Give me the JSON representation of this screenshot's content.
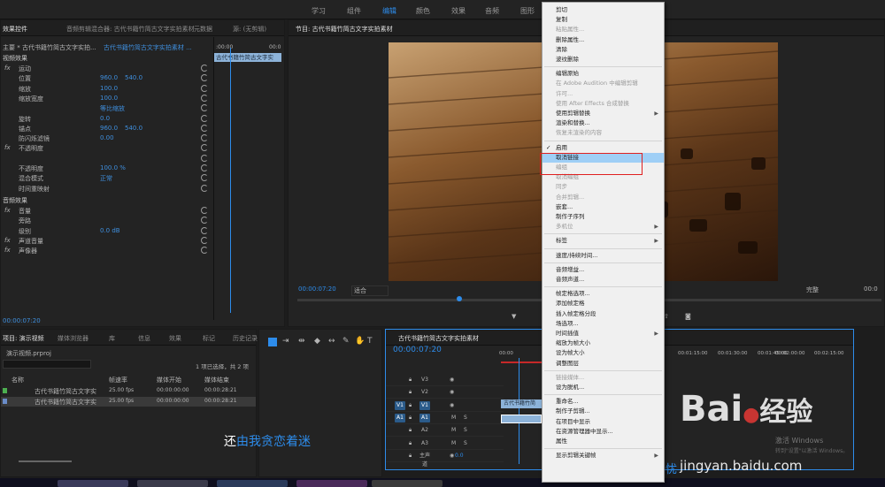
{
  "workspaces": [
    "学习",
    "组件",
    "编辑",
    "颜色",
    "效果",
    "音频",
    "图形"
  ],
  "effect_panel": {
    "tabs": [
      "效果控件",
      "音频剪辑混合器: 古代书籍竹简古文字实拍素材",
      "元数据",
      "源: (无剪辑)"
    ],
    "source_row": "主要 * 古代书籍竹简古文字实拍...",
    "clip_row": "古代书籍竹简古文字实拍素材 ...",
    "clip_bar": "古代书籍竹简古文字实",
    "section_video": "视频效果",
    "rows": [
      {
        "fx": "fx",
        "label": "运动",
        "v1": "",
        "v2": ""
      },
      {
        "fx": "",
        "label": "位置",
        "v1": "960.0",
        "v2": "540.0"
      },
      {
        "fx": "",
        "label": "缩放",
        "v1": "100.0",
        "v2": ""
      },
      {
        "fx": "",
        "label": "缩放宽度",
        "v1": "100.0",
        "v2": ""
      },
      {
        "fx": "",
        "label": "",
        "v1": "等比缩放",
        "v2": ""
      },
      {
        "fx": "",
        "label": "旋转",
        "v1": "0.0",
        "v2": ""
      },
      {
        "fx": "",
        "label": "锚点",
        "v1": "960.0",
        "v2": "540.0"
      },
      {
        "fx": "",
        "label": "防闪烁滤镜",
        "v1": "0.00",
        "v2": ""
      },
      {
        "fx": "fx",
        "label": "不透明度",
        "v1": "",
        "v2": ""
      },
      {
        "fx": "",
        "label": "",
        "v1": "",
        "v2": ""
      },
      {
        "fx": "",
        "label": "不透明度",
        "v1": "100.0 %",
        "v2": ""
      },
      {
        "fx": "",
        "label": "混合模式",
        "v1": "正常",
        "v2": ""
      },
      {
        "fx": "",
        "label": "时间重映射",
        "v1": "",
        "v2": ""
      }
    ],
    "section_audio": "音频效果",
    "audio_rows": [
      {
        "fx": "fx",
        "label": "音量",
        "v1": ""
      },
      {
        "fx": "",
        "label": "旁路",
        "v1": ""
      },
      {
        "fx": "",
        "label": "级别",
        "v1": "0.0 dB"
      },
      {
        "fx": "fx",
        "label": "声道音量",
        "v1": ""
      },
      {
        "fx": "fx",
        "label": "声像器",
        "v1": ""
      }
    ],
    "timecode": "00:00:07:20",
    "ruler_start": ":00:00",
    "ruler_end": "00:0"
  },
  "program": {
    "title": "节目: 古代书籍竹简古文字实拍素材",
    "timecode": "00:00:07:20",
    "fit": "适合",
    "quality": "完整",
    "right_tc": "00:0"
  },
  "project": {
    "tabs": [
      "项目: 演示视频",
      "媒体浏览器",
      "库",
      "信息",
      "效果",
      "标记",
      "历史记录"
    ],
    "file": "演示视频.prproj",
    "selection": "1 项已选择，共 2 项",
    "headers": [
      "名称",
      "帧速率",
      "媒体开始",
      "媒体结束"
    ],
    "items": [
      {
        "name": "古代书籍竹简古文字实",
        "fps": "25.00 fps",
        "start": "00:00:00:00",
        "end": "00:00:28:21"
      },
      {
        "name": "古代书籍竹简古文字实",
        "fps": "25.00 fps",
        "start": "00:00:00:00",
        "end": "00:00:28:21"
      }
    ]
  },
  "timeline": {
    "title": "古代书籍竹简古文字实拍素材",
    "timecode": "00:00:07:20",
    "tracks": [
      "V3",
      "V2",
      "V1",
      "A1",
      "A2",
      "A3",
      "主声道"
    ],
    "master_value": "0.0",
    "ruler": [
      "00:00",
      "00:01:15:00",
      "00:01:30:00",
      "00:01:45:00",
      "00:02:00:00",
      "00:02:15:00"
    ],
    "clip_label": "古代书籍竹简"
  },
  "subtitle": {
    "first": "还",
    "rest": "由我贪恋着迷",
    "last": "忧"
  },
  "context_menu": {
    "items": [
      {
        "label": "剪切",
        "disabled": false
      },
      {
        "label": "复制",
        "disabled": false
      },
      {
        "label": "粘贴属性...",
        "disabled": true
      },
      {
        "label": "删除属性...",
        "disabled": false
      },
      {
        "label": "清除",
        "disabled": false
      },
      {
        "label": "波纹删除",
        "disabled": false
      },
      {
        "sep": true
      },
      {
        "label": "编辑原始",
        "disabled": false
      },
      {
        "label": "在 Adobe Audition 中编辑剪辑",
        "disabled": true
      },
      {
        "label": "许可...",
        "disabled": true
      },
      {
        "label": "使用 After Effects 合成替换",
        "disabled": true
      },
      {
        "label": "使用剪辑替换",
        "disabled": false,
        "sub": true
      },
      {
        "label": "渲染和替换...",
        "disabled": false
      },
      {
        "label": "恢复未渲染的内容",
        "disabled": true
      },
      {
        "sep": true
      },
      {
        "label": "启用",
        "disabled": false,
        "check": true
      },
      {
        "label": "取消链接",
        "disabled": false,
        "highlight": true
      },
      {
        "label": "编组",
        "disabled": true
      },
      {
        "label": "取消编组",
        "disabled": true
      },
      {
        "label": "同步",
        "disabled": true
      },
      {
        "label": "合并剪辑...",
        "disabled": true
      },
      {
        "label": "嵌套...",
        "disabled": false
      },
      {
        "label": "制作子序列",
        "disabled": false
      },
      {
        "label": "多机位",
        "disabled": true,
        "sub": true
      },
      {
        "sep": true
      },
      {
        "label": "标签",
        "disabled": false,
        "sub": true
      },
      {
        "sep": true
      },
      {
        "label": "速度/持续时间...",
        "disabled": false
      },
      {
        "sep": true
      },
      {
        "label": "音频增益...",
        "disabled": false
      },
      {
        "label": "音频声道...",
        "disabled": false
      },
      {
        "sep": true
      },
      {
        "label": "帧定格选项...",
        "disabled": false
      },
      {
        "label": "添加帧定格",
        "disabled": false
      },
      {
        "label": "插入帧定格分段",
        "disabled": false
      },
      {
        "label": "场选项...",
        "disabled": false
      },
      {
        "label": "时间插值",
        "disabled": false,
        "sub": true
      },
      {
        "label": "缩放为帧大小",
        "disabled": false
      },
      {
        "label": "设为帧大小",
        "disabled": false
      },
      {
        "label": "调整图层",
        "disabled": false
      },
      {
        "sep": true
      },
      {
        "label": "链接媒体...",
        "disabled": true
      },
      {
        "label": "设为脱机...",
        "disabled": false
      },
      {
        "sep": true
      },
      {
        "label": "重命名...",
        "disabled": false
      },
      {
        "label": "制作子剪辑...",
        "disabled": false
      },
      {
        "label": "在项目中显示",
        "disabled": false
      },
      {
        "label": "在资源管理器中显示...",
        "disabled": false
      },
      {
        "label": "属性",
        "disabled": false
      },
      {
        "sep": true
      },
      {
        "label": "显示剪辑关键帧",
        "disabled": false,
        "sub": true
      }
    ]
  },
  "watermark": {
    "brand": "Bai",
    "brand2": "经验",
    "url": "jingyan.baidu.com",
    "win1": "激活 Windows",
    "win2": "转到\"设置\"以激活 Windows。"
  },
  "colors": {
    "accent": "#2d8ceb",
    "highlight": "#9fcff6",
    "menu_bg": "#f0f0f0",
    "panel": "#232323",
    "clip": "#8db3d9"
  }
}
